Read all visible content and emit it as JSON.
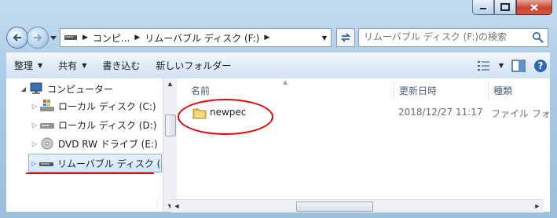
{
  "window": {
    "caption_buttons": [
      "minimize",
      "maximize",
      "close"
    ]
  },
  "address": {
    "segments": [
      "コンピ...",
      "リムーバブル ディスク (F:)"
    ],
    "search_placeholder": "リムーバブル ディスク (F:)の検索"
  },
  "toolbar": {
    "organize": "整理",
    "share": "共有",
    "burn": "書き込む",
    "new_folder": "新しいフォルダー"
  },
  "tree": {
    "computer": "コンピューター",
    "items": [
      {
        "label": "ローカル ディスク (C:)"
      },
      {
        "label": "ローカル ディスク (D:)"
      },
      {
        "label": "DVD RW ドライブ (E:)"
      },
      {
        "label": "リムーバブル ディスク ("
      }
    ]
  },
  "columns": {
    "name": "名前",
    "date": "更新日時",
    "type": "種類"
  },
  "files": [
    {
      "name": "newpec",
      "date": "2018/12/27 11:17",
      "type": "ファイル フォル"
    }
  ],
  "colors": {
    "annotation": "#e30000",
    "folder": "#e8c25a",
    "selection": "#cfe6fb"
  }
}
